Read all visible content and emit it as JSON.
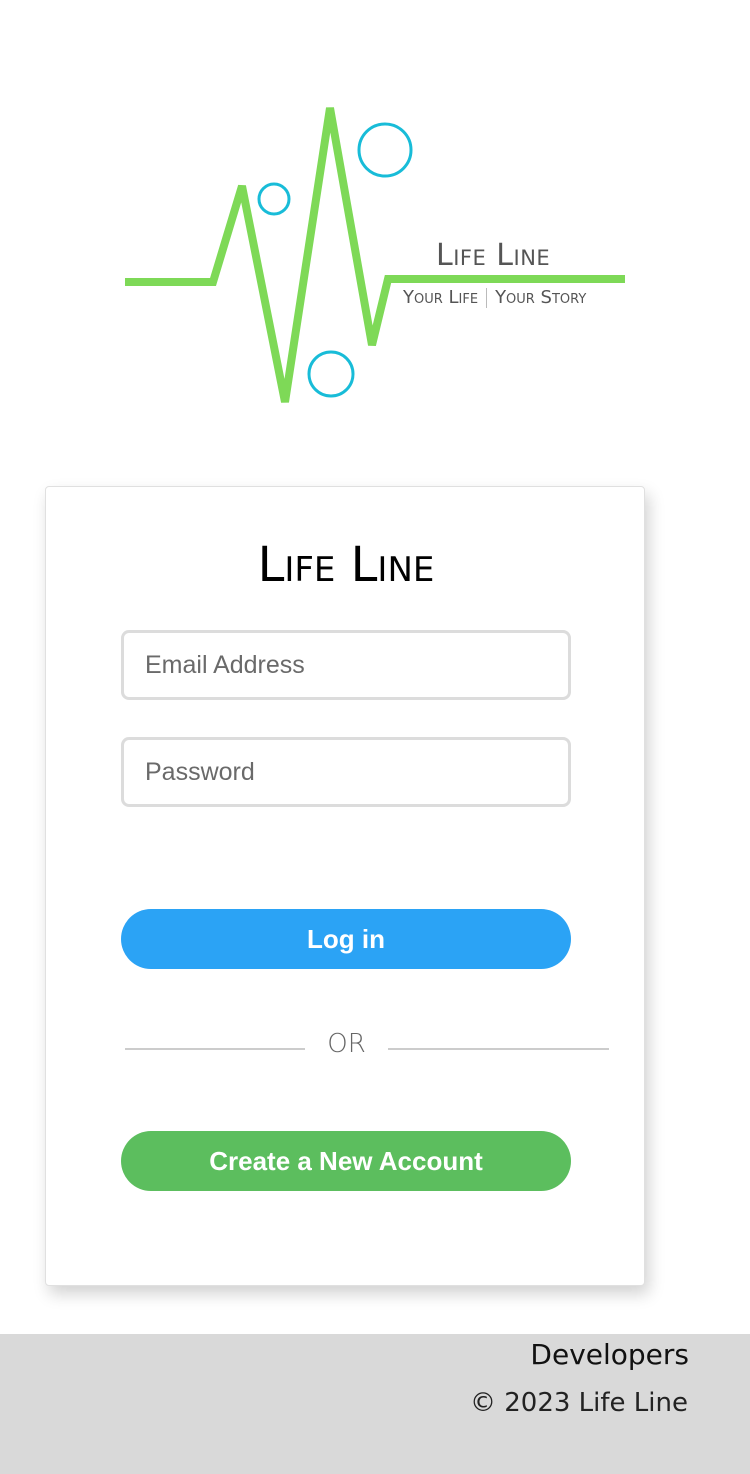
{
  "logo": {
    "title": "Life Line",
    "tagline_left": "Your Life",
    "tagline_right": "Your Story",
    "line_color": "#7ed957",
    "circle_color": "#18bcd8"
  },
  "card": {
    "title": "Life Line",
    "email_placeholder": "Email Address",
    "password_placeholder": "Password",
    "login_label": "Log in",
    "divider_label": "OR",
    "create_label": "Create a New Account"
  },
  "footer": {
    "developers_link": "Developers",
    "copyright": "© 2023 Life Line"
  },
  "colors": {
    "login_button": "#2ba3f5",
    "create_button": "#5cbe5e",
    "footer_bg": "#d9d9d9"
  }
}
